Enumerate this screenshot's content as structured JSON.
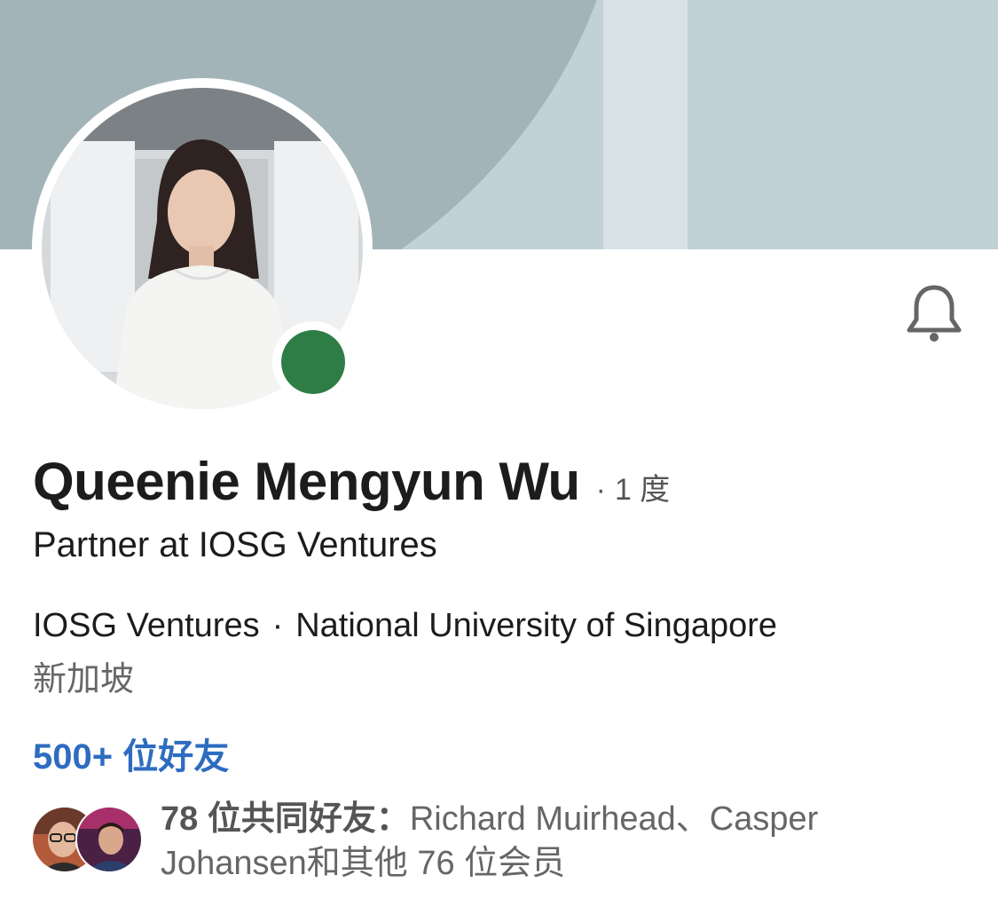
{
  "profile": {
    "name": "Queenie Mengyun Wu",
    "degree_separator": "·",
    "degree": "1 度",
    "headline": "Partner at IOSG Ventures",
    "company": "IOSG Ventures",
    "org_separator": "·",
    "school": "National University of Singapore",
    "location": "新加坡",
    "connections": "500+ 位好友",
    "online_status_color": "#2e7d46"
  },
  "mutual": {
    "count_label": "78 位共同好友：",
    "names_line": "Richard Muirhead、Casper Johansen和其他 76 位会员"
  },
  "icons": {
    "notify": "bell-icon"
  },
  "colors": {
    "link": "#2d6cc0",
    "online": "#2e7d46",
    "banner": "#a3b4b9"
  }
}
